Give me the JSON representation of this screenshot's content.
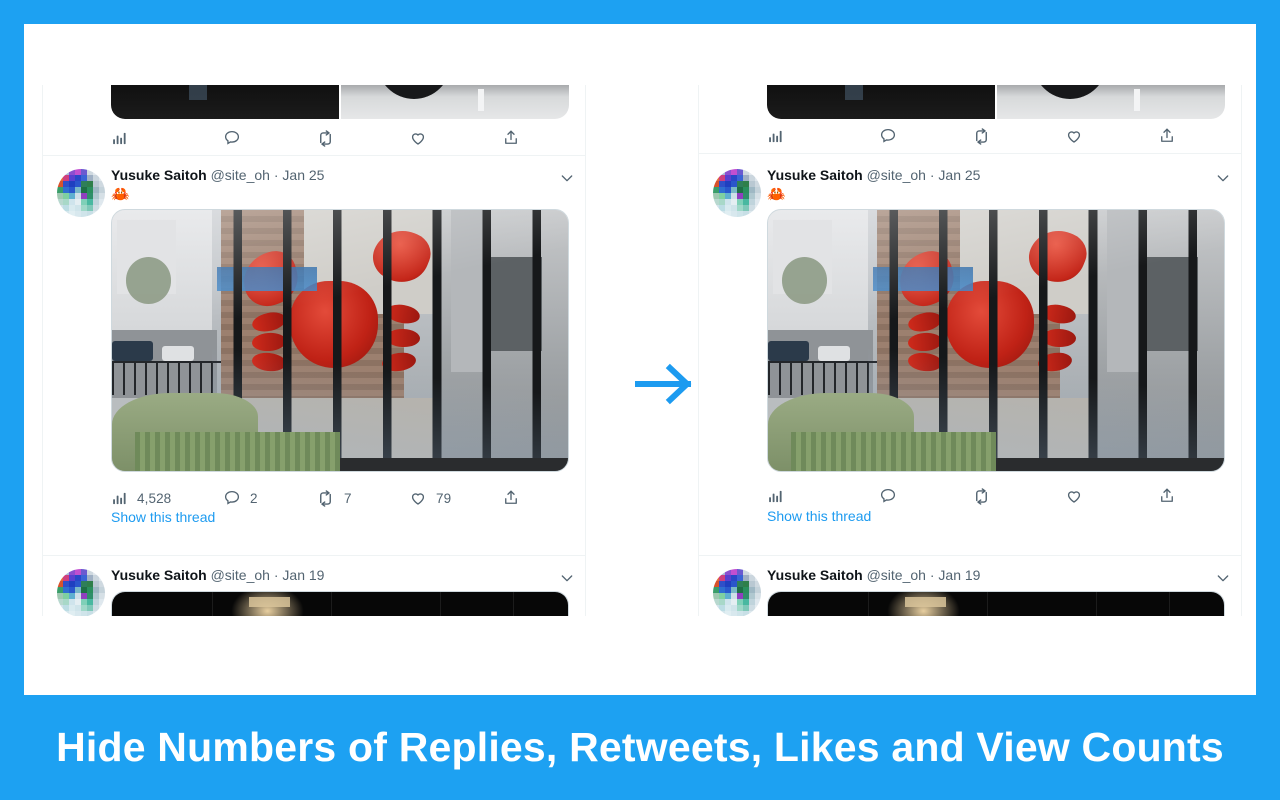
{
  "caption": {
    "text": "Hide Numbers of Replies, Retweets, Likes and View Counts"
  },
  "colors": {
    "brand_blue": "#1da1f2",
    "link_blue": "#1d9bf0",
    "text_primary": "#0f1419",
    "text_secondary": "#536471",
    "border": "#eff3f4",
    "card_background": "#ffffff"
  },
  "arrow": {
    "name": "right-arrow",
    "direction": "right",
    "color": "#1d9bf0"
  },
  "panes": [
    {
      "id": "before",
      "position": "left",
      "counts_visible": true,
      "partial_tweet": {
        "media_alt": "parking-lot-photo-pair",
        "actions": [
          {
            "icon": "views-icon",
            "label": "Views",
            "count": ""
          },
          {
            "icon": "reply-icon",
            "label": "Reply",
            "count": ""
          },
          {
            "icon": "retweet-icon",
            "label": "Retweet",
            "count": ""
          },
          {
            "icon": "like-icon",
            "label": "Like",
            "count": ""
          },
          {
            "icon": "share-icon",
            "label": "Share",
            "count": ""
          }
        ]
      },
      "tweets": [
        {
          "author": "Yusuke Saitoh",
          "handle": "@site_oh",
          "separator": "·",
          "date": "Jan 25",
          "text": "🦀",
          "media_alt": "giant-red-crab-sculpture-behind-glass",
          "caret": "chevron-down-icon",
          "thread_link": "Show this thread",
          "actions": [
            {
              "icon": "views-icon",
              "label": "Views",
              "count": "4,528"
            },
            {
              "icon": "reply-icon",
              "label": "Reply",
              "count": "2"
            },
            {
              "icon": "retweet-icon",
              "label": "Retweet",
              "count": "7"
            },
            {
              "icon": "like-icon",
              "label": "Like",
              "count": "79"
            },
            {
              "icon": "share-icon",
              "label": "Share",
              "count": ""
            }
          ]
        },
        {
          "author": "Yusuke Saitoh",
          "handle": "@site_oh",
          "separator": "·",
          "date": "Jan 19",
          "text": "",
          "media_alt": "dark-night-photo",
          "caret": "chevron-down-icon"
        }
      ]
    },
    {
      "id": "after",
      "position": "right",
      "counts_visible": false,
      "partial_tweet": {
        "media_alt": "parking-lot-photo-pair",
        "actions": [
          {
            "icon": "views-icon",
            "label": "Views",
            "count": ""
          },
          {
            "icon": "reply-icon",
            "label": "Reply",
            "count": ""
          },
          {
            "icon": "retweet-icon",
            "label": "Retweet",
            "count": ""
          },
          {
            "icon": "like-icon",
            "label": "Like",
            "count": ""
          },
          {
            "icon": "share-icon",
            "label": "Share",
            "count": ""
          }
        ]
      },
      "tweets": [
        {
          "author": "Yusuke Saitoh",
          "handle": "@site_oh",
          "separator": "·",
          "date": "Jan 25",
          "text": "🦀",
          "media_alt": "giant-red-crab-sculpture-behind-glass",
          "caret": "chevron-down-icon",
          "thread_link": "Show this thread",
          "actions": [
            {
              "icon": "views-icon",
              "label": "Views",
              "count": ""
            },
            {
              "icon": "reply-icon",
              "label": "Reply",
              "count": ""
            },
            {
              "icon": "retweet-icon",
              "label": "Retweet",
              "count": ""
            },
            {
              "icon": "like-icon",
              "label": "Like",
              "count": ""
            },
            {
              "icon": "share-icon",
              "label": "Share",
              "count": ""
            }
          ]
        },
        {
          "author": "Yusuke Saitoh",
          "handle": "@site_oh",
          "separator": "·",
          "date": "Jan 19",
          "text": "",
          "media_alt": "dark-night-photo",
          "caret": "chevron-down-icon"
        }
      ]
    }
  ]
}
